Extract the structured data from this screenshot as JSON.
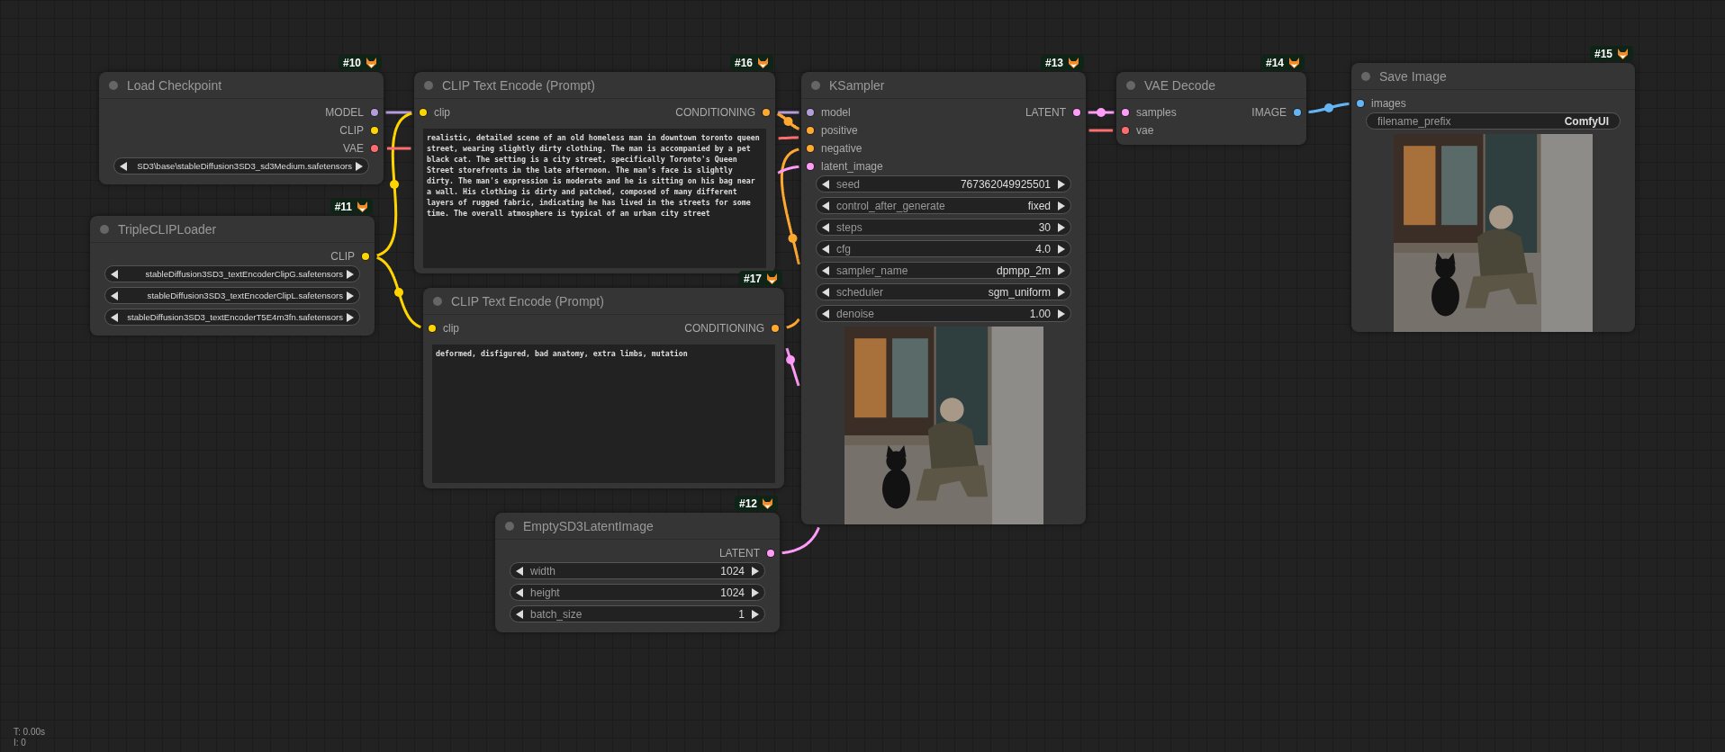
{
  "nodes": [
    {
      "id": "#10",
      "title": "Load Checkpoint",
      "outputs": [
        {
          "label": "MODEL",
          "color": "#b39ddb"
        },
        {
          "label": "CLIP",
          "color": "#ffd500"
        },
        {
          "label": "VAE",
          "color": "#ff6e6e"
        }
      ],
      "widgets": [
        {
          "kind": "combo",
          "value": "SD3\\base\\stableDiffusion3SD3_sd3Medium.safetensors"
        }
      ]
    },
    {
      "id": "#11",
      "title": "TripleCLIPLoader",
      "outputs": [
        {
          "label": "CLIP",
          "color": "#ffd500"
        }
      ],
      "widgets": [
        {
          "kind": "combo",
          "value": "stableDiffusion3SD3_textEncoderClipG.safetensors"
        },
        {
          "kind": "combo",
          "value": "stableDiffusion3SD3_textEncoderClipL.safetensors"
        },
        {
          "kind": "combo",
          "value": "stableDiffusion3SD3_textEncoderT5E4m3fn.safetensors"
        }
      ]
    },
    {
      "id": "#16",
      "title": "CLIP Text Encode (Prompt)",
      "inputs": [
        {
          "label": "clip",
          "color": "#ffd500"
        }
      ],
      "outputs": [
        {
          "label": "CONDITIONING",
          "color": "#ffa931"
        }
      ],
      "prompt": "realistic, detailed scene of an old homeless man in downtown toronto queen street, wearing slightly dirty clothing. The man is accompanied by a pet black cat. The setting is a city street, specifically Toronto's Queen Street storefronts in the late afternoon. The man's face is slightly dirty. The man's expression is moderate and he is sitting on his bag near a wall. His clothing is dirty and patched, composed of many different layers of rugged fabric, indicating he has lived in the streets for some time. The overall atmosphere is typical of an urban city street"
    },
    {
      "id": "#17",
      "title": "CLIP Text Encode (Prompt)",
      "inputs": [
        {
          "label": "clip",
          "color": "#ffd500"
        }
      ],
      "outputs": [
        {
          "label": "CONDITIONING",
          "color": "#ffa931"
        }
      ],
      "prompt": "deformed, disfigured, bad anatomy, extra limbs, mutation"
    },
    {
      "id": "#12",
      "title": "EmptySD3LatentImage",
      "outputs": [
        {
          "label": "LATENT",
          "color": "#ff9cf9"
        }
      ],
      "widgets": [
        {
          "kind": "number",
          "label": "width",
          "value": "1024"
        },
        {
          "kind": "number",
          "label": "height",
          "value": "1024"
        },
        {
          "kind": "number",
          "label": "batch_size",
          "value": "1"
        }
      ]
    },
    {
      "id": "#13",
      "title": "KSampler",
      "inputs": [
        {
          "label": "model",
          "color": "#b39ddb"
        },
        {
          "label": "positive",
          "color": "#ffa931"
        },
        {
          "label": "negative",
          "color": "#ffa931"
        },
        {
          "label": "latent_image",
          "color": "#ff9cf9"
        }
      ],
      "outputs": [
        {
          "label": "LATENT",
          "color": "#ff9cf9"
        }
      ],
      "widgets": [
        {
          "kind": "number",
          "label": "seed",
          "value": "767362049925501"
        },
        {
          "kind": "combo",
          "label": "control_after_generate",
          "value": "fixed"
        },
        {
          "kind": "number",
          "label": "steps",
          "value": "30"
        },
        {
          "kind": "number",
          "label": "cfg",
          "value": "4.0"
        },
        {
          "kind": "combo",
          "label": "sampler_name",
          "value": "dpmpp_2m"
        },
        {
          "kind": "combo",
          "label": "scheduler",
          "value": "sgm_uniform"
        },
        {
          "kind": "number",
          "label": "denoise",
          "value": "1.00"
        }
      ],
      "preview": {
        "kind": "picture"
      }
    },
    {
      "id": "#14",
      "title": "VAE Decode",
      "inputs": [
        {
          "label": "samples",
          "color": "#ff9cf9"
        },
        {
          "label": "vae",
          "color": "#ff6e6e"
        }
      ],
      "outputs": [
        {
          "label": "IMAGE",
          "color": "#64b5f6"
        }
      ]
    },
    {
      "id": "#15",
      "title": "Save Image",
      "inputs": [
        {
          "label": "images",
          "color": "#64b5f6"
        }
      ],
      "widgets": [
        {
          "kind": "text",
          "label": "filename_prefix",
          "value": "ComfyUI"
        }
      ],
      "preview": {
        "kind": "picture"
      }
    }
  ],
  "stats": [
    "T: 0.00s",
    "I: 0"
  ]
}
